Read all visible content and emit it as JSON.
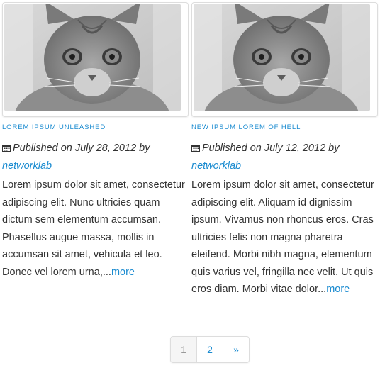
{
  "posts": [
    {
      "title": "LOREM IPSUM UNLEASHED",
      "published_prefix": "Published on July 28, 2012 by",
      "author": "networklab",
      "excerpt": "Lorem ipsum dolor sit amet, consectetur adipiscing elit. Nunc ultricies quam dictum sem elementum accumsan. Phasellus augue massa, mollis in accumsan sit amet, vehicula et leo. Donec vel lorem urna,...",
      "more_label": "more",
      "image_icon": "cat-photo"
    },
    {
      "title": "NEW IPSUM LOREM OF HELL",
      "published_prefix": "Published on July 12, 2012 by",
      "author": "networklab",
      "excerpt": "Lorem ipsum dolor sit amet, consectetur adipiscing elit. Aliquam id dignissim ipsum. Vivamus non rhoncus eros. Cras ultricies felis non magna pharetra eleifend. Morbi nibh magna, elementum quis varius vel, fringilla nec velit. Ut quis eros diam. Morbi vitae dolor...",
      "more_label": "more",
      "image_icon": "cat-photo"
    }
  ],
  "pagination": {
    "pages": [
      "1",
      "2"
    ],
    "current": "1",
    "next_label": "»"
  },
  "colors": {
    "link": "#1a8bd0",
    "text": "#333333",
    "border": "#dddddd"
  }
}
